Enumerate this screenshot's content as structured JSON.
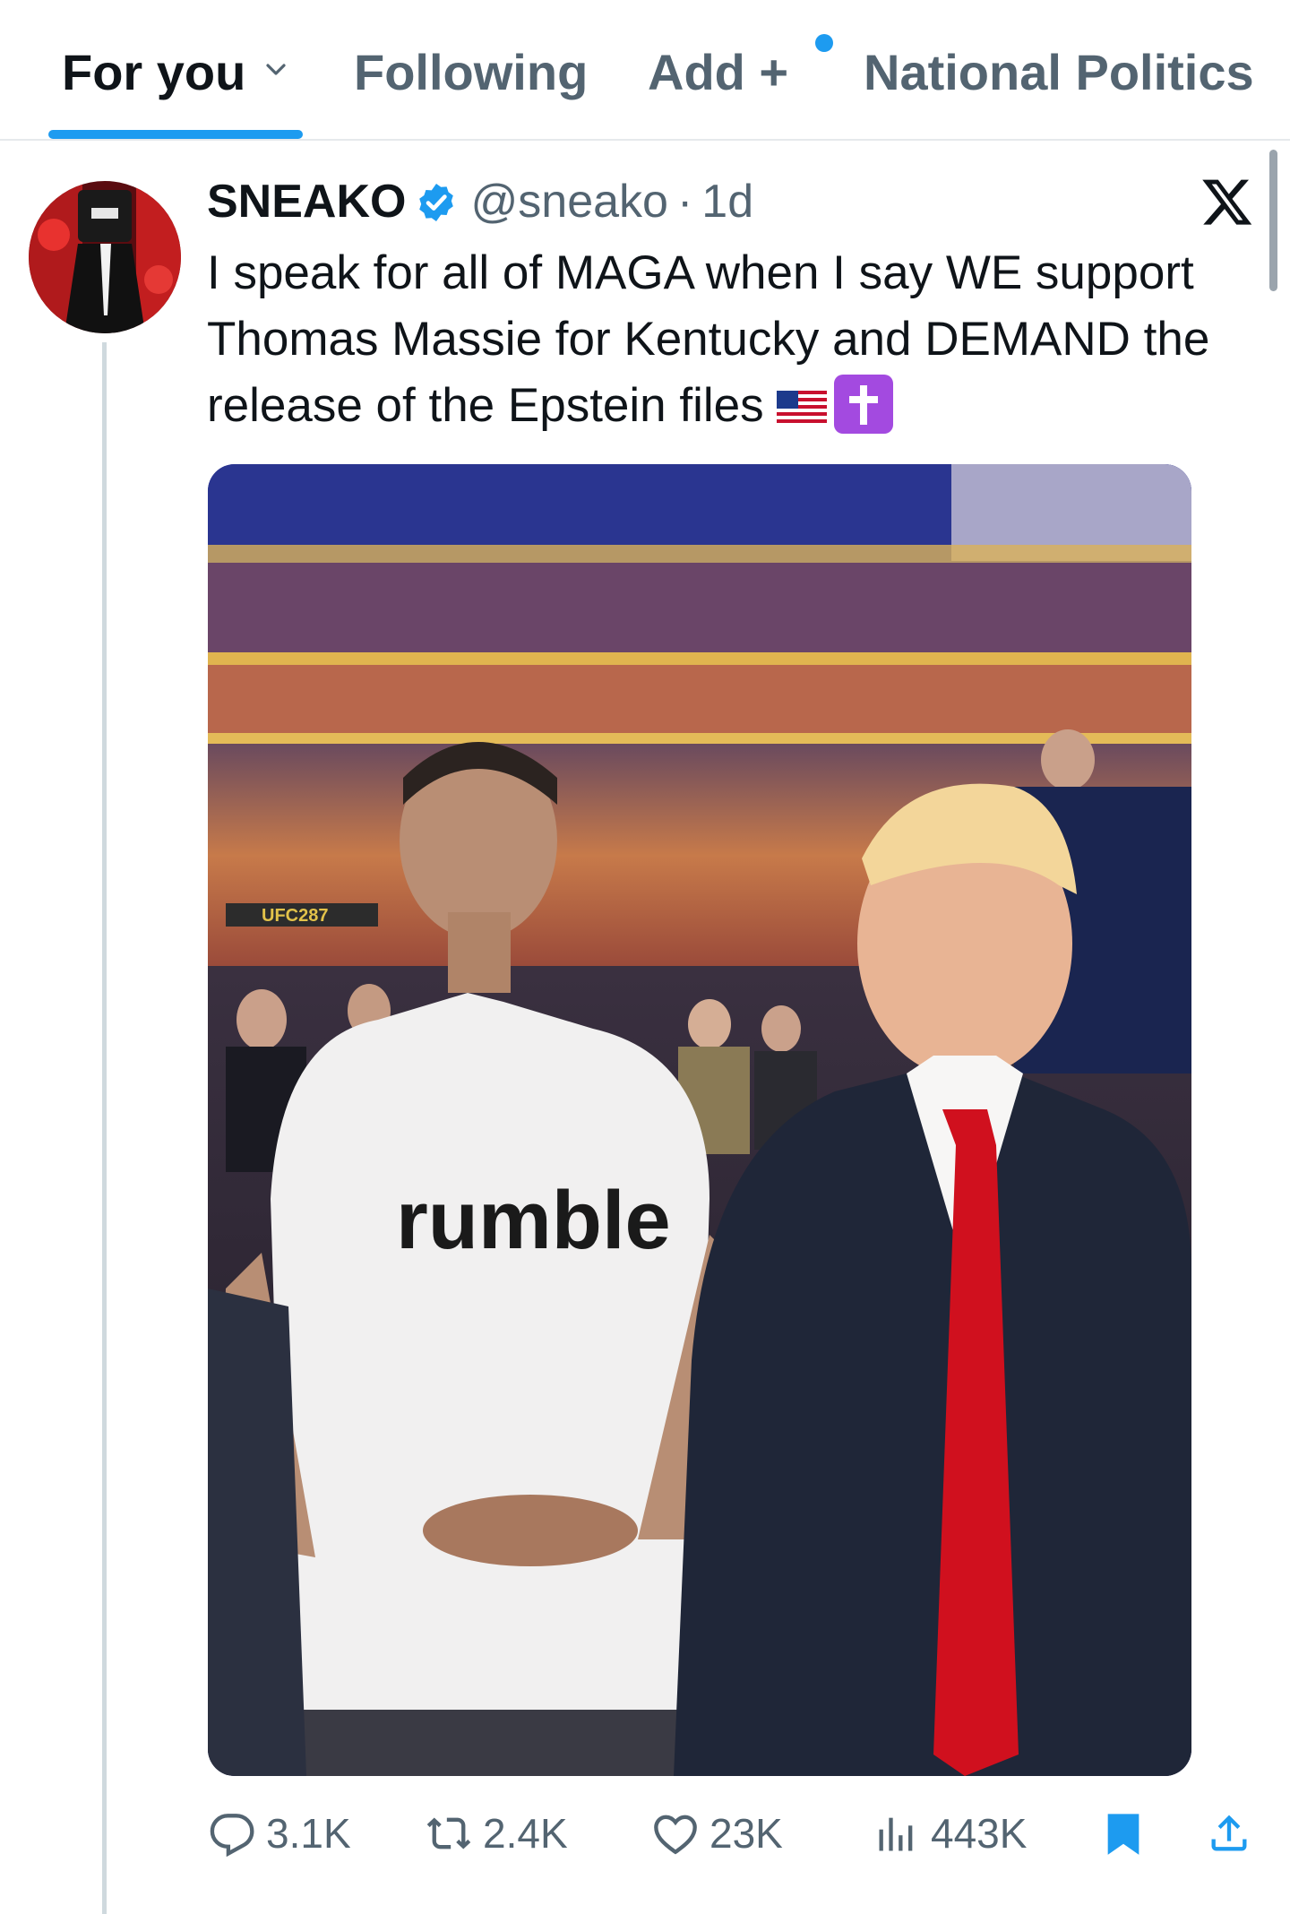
{
  "tabs": {
    "for_you": "For you",
    "following": "Following",
    "add": "Add +",
    "national_politics": "National Politics"
  },
  "tweet": {
    "display_name": "SNEAKO",
    "handle": "@sneako",
    "separator": "·",
    "time": "1d",
    "text": "I speak for all of MAGA when I say WE support Thomas Massie for Kentucky and DEMAND the release of the Epstein files",
    "emojis": [
      "us-flag",
      "latin-cross"
    ],
    "photo_shirt_text": "rumble",
    "photo_sign_text": "UFC287"
  },
  "metrics": {
    "replies": "3.1K",
    "reposts": "2.4K",
    "likes": "23K",
    "views": "443K"
  },
  "colors": {
    "accent": "#1d9bf0",
    "text_primary": "#0f1419",
    "text_secondary": "#536471",
    "tie_red": "#d0101e",
    "cross_purple": "#a34ae0"
  },
  "icons": [
    "chevron-down-icon",
    "verified-badge-icon",
    "x-logo-icon",
    "reply-icon",
    "repost-icon",
    "like-icon",
    "views-icon",
    "bookmark-icon",
    "share-icon"
  ]
}
